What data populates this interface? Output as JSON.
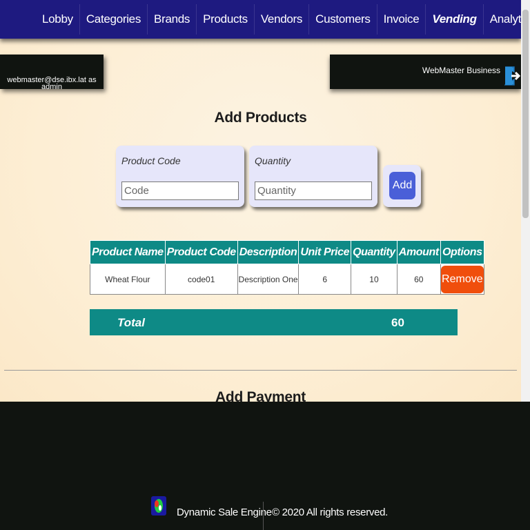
{
  "nav": {
    "items": [
      {
        "label": "Lobby"
      },
      {
        "label": "Categories"
      },
      {
        "label": "Brands"
      },
      {
        "label": "Products"
      },
      {
        "label": "Vendors"
      },
      {
        "label": "Customers"
      },
      {
        "label": "Invoice"
      },
      {
        "label": "Vending"
      },
      {
        "label": "Analytics"
      }
    ],
    "active": "Vending"
  },
  "user": {
    "email": "webmaster@dse.ibx.lat as",
    "role": "admin"
  },
  "business": {
    "name": "WebMaster Business",
    "logout_icon": "logout-icon"
  },
  "add_products": {
    "title": "Add Products",
    "code_label": "Product Code",
    "code_placeholder": "Code",
    "qty_label": "Quantity",
    "qty_placeholder": "Quantity",
    "add_label": "Add"
  },
  "table": {
    "headers": [
      "Product Name",
      "Product Code",
      "Description",
      "Unit Price",
      "Quantity",
      "Amount",
      "Options"
    ],
    "rows": [
      {
        "name": "Wheat Flour",
        "code": "code01",
        "description": "Description One",
        "unit_price": "6",
        "quantity": "10",
        "amount": "60",
        "option": "Remove"
      }
    ]
  },
  "total": {
    "label": "Total",
    "value": "60"
  },
  "add_payment": {
    "title": "Add Payment"
  },
  "footer": {
    "brand": "Dynamic Sale Engine",
    "copyright": "© 2020 All rights reserved."
  },
  "colors": {
    "navbar": "#1e1a80",
    "teal": "#0e8a86",
    "remove": "#f04e0c",
    "add": "#4a5fd8",
    "dark": "#101410"
  }
}
